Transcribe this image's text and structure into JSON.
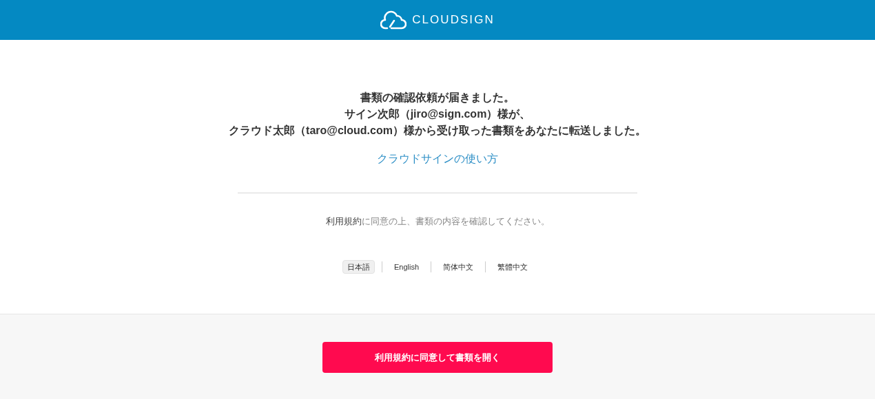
{
  "header": {
    "logo": "**CLOUD**SIGN"
  },
  "message": {
    "lines": [
      "書類の確認依頼が届きました。",
      "サイン次郎（jiro@sign.com）様が、",
      "クラウド太郎（taro@cloud.com）様から受け取った書類をあなたに転送しました。"
    ],
    "help_link": "クラウドサインの使い方"
  },
  "terms": {
    "link": "利用規約",
    "rest": "に同意の上、書類の内容を確認してください。"
  },
  "languages": [
    {
      "label": "日本語",
      "selected": true
    },
    {
      "label": "English",
      "selected": false
    },
    {
      "label": "简体中文",
      "selected": false
    },
    {
      "label": "繁體中文",
      "selected": false
    }
  ],
  "footer": {
    "button": "利用規約に同意して書類を開く"
  }
}
